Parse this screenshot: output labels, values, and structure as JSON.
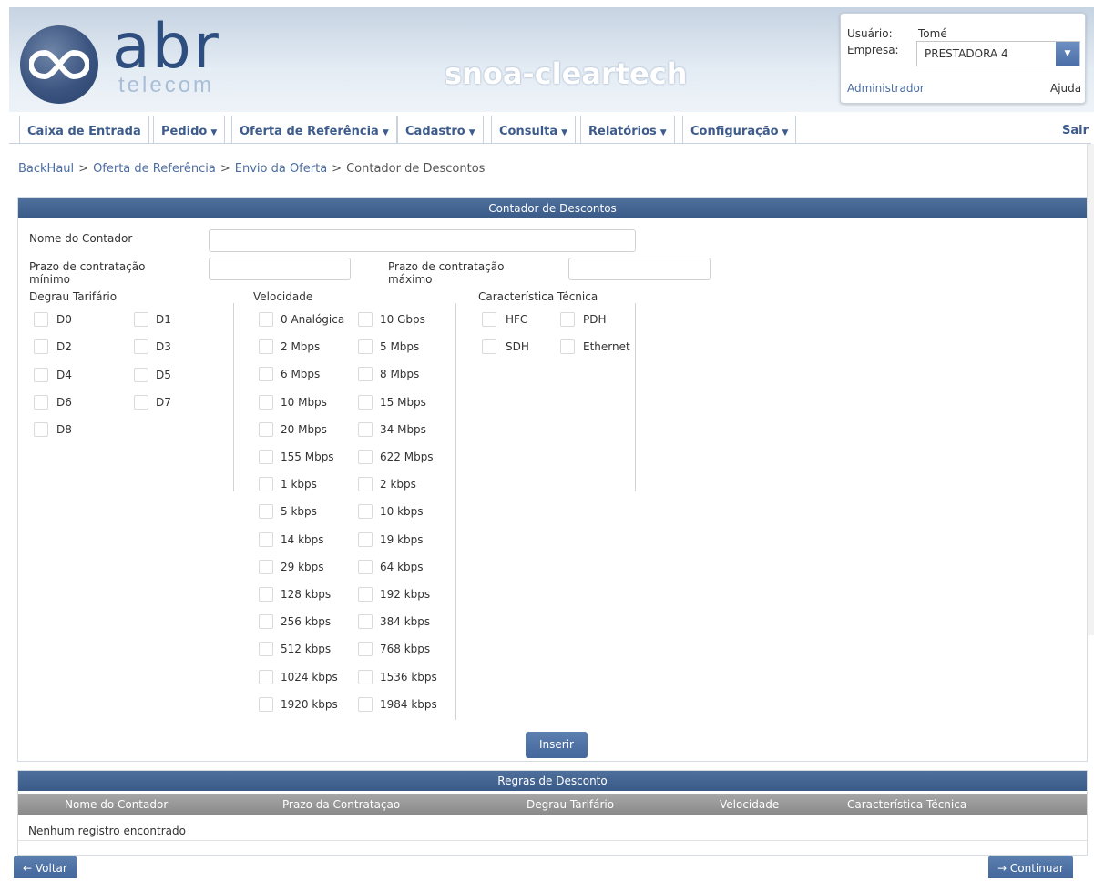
{
  "header": {
    "logo_text": "abr",
    "logo_sub": "telecom",
    "app_title": "snoa-cleartech"
  },
  "user_panel": {
    "user_label": "Usuário:",
    "user_value": "Tomé",
    "company_label": "Empresa:",
    "company_value": "PRESTADORA 4",
    "admin_link": "Administrador",
    "help_link": "Ajuda"
  },
  "nav": {
    "items": [
      {
        "label": "Caixa de Entrada",
        "dropdown": false
      },
      {
        "label": "Pedido",
        "dropdown": true
      },
      {
        "label": "Oferta de Referência",
        "dropdown": true
      },
      {
        "label": "Cadastro",
        "dropdown": true
      },
      {
        "label": "Consulta",
        "dropdown": true
      },
      {
        "label": "Relatórios",
        "dropdown": true
      },
      {
        "label": "Configuração",
        "dropdown": true
      }
    ],
    "logout": "Sair"
  },
  "breadcrumb": {
    "items": [
      "BackHaul",
      "Oferta de Referência",
      "Envio da Oferta"
    ],
    "current": "Contador de Descontos",
    "separator": ">"
  },
  "form": {
    "title": "Contador de Descontos",
    "name_label": "Nome do Contador",
    "name_value": "",
    "min_label_1": "Prazo de contratação",
    "min_label_2": "mínimo",
    "min_value": "",
    "max_label_1": "Prazo de contratação",
    "max_label_2": "máximo",
    "max_value": "",
    "degrau_label": "Degrau Tarifário",
    "velocidade_label": "Velocidade",
    "tecnica_label": "Característica Técnica",
    "degrau_options": [
      "D0",
      "D1",
      "D2",
      "D3",
      "D4",
      "D5",
      "D6",
      "D7",
      "D8"
    ],
    "velocidade_options": [
      "0 Analógica",
      "10 Gbps",
      "2 Mbps",
      "5 Mbps",
      "6 Mbps",
      "8 Mbps",
      "10 Mbps",
      "15 Mbps",
      "20 Mbps",
      "34 Mbps",
      "155 Mbps",
      "622 Mbps",
      "1 kbps",
      "2 kbps",
      "5 kbps",
      "10 kbps",
      "14 kbps",
      "19 kbps",
      "29 kbps",
      "64 kbps",
      "128 kbps",
      "192 kbps",
      "256 kbps",
      "384 kbps",
      "512 kbps",
      "768 kbps",
      "1024 kbps",
      "1536 kbps",
      "1920 kbps",
      "1984 kbps"
    ],
    "tecnica_options": [
      "HFC",
      "PDH",
      "SDH",
      "Ethernet"
    ],
    "insert_button": "Inserir"
  },
  "rules": {
    "title": "Regras de Desconto",
    "columns": [
      "Nome do Contador",
      "Prazo da Contrataçao",
      "Degrau Tarifário",
      "Velocidade",
      "Característica Técnica"
    ],
    "empty_message": "Nenhum registro encontrado"
  },
  "footer": {
    "back_button": "Voltar",
    "continue_button": "Continuar"
  },
  "colors": {
    "primary": "#44679c",
    "link": "#4b6da3",
    "header_bg": "#c6d3e2"
  }
}
